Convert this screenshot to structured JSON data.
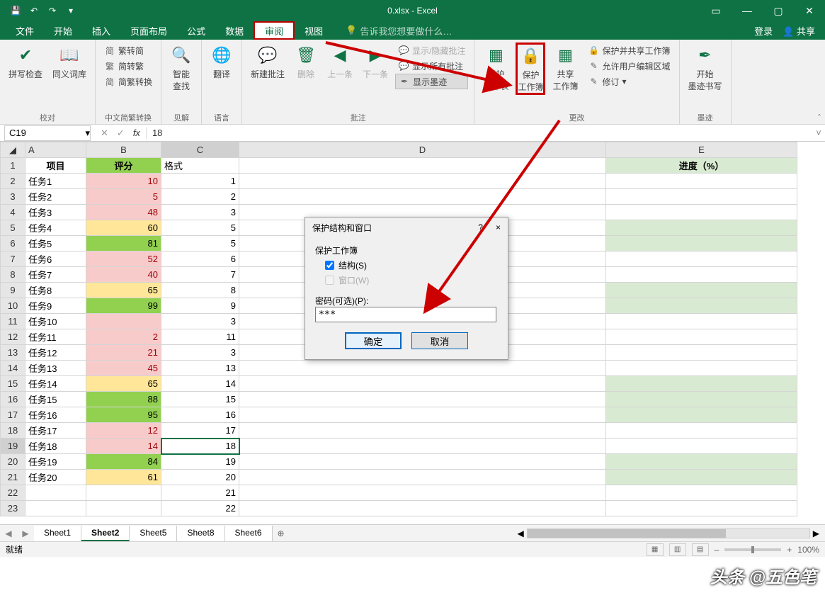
{
  "window": {
    "title": "0.xlsx - Excel"
  },
  "menubar": {
    "file": "文件",
    "home": "开始",
    "insert": "插入",
    "layout": "页面布局",
    "formulas": "公式",
    "data": "数据",
    "review": "审阅",
    "view": "视图",
    "tell": "告诉我您想要做什么…",
    "login": "登录",
    "share": "共享"
  },
  "ribbon": {
    "groups": {
      "proof": {
        "label": "校对",
        "spell": "拼写检查",
        "thesaurus": "同义词库"
      },
      "chinese": {
        "label": "中文简繁转换",
        "simp": "繁转简",
        "trad": "简转繁",
        "conv": "简繁转换"
      },
      "insights": {
        "label": "见解",
        "smart": "智能\n查找"
      },
      "lang": {
        "label": "语言",
        "translate": "翻译"
      },
      "comments": {
        "label": "批注",
        "new": "新建批注",
        "delete": "删除",
        "prev": "上一条",
        "next": "下一条",
        "showhide": "显示/隐藏批注",
        "showall": "显示所有批注",
        "ink": "显示墨迹"
      },
      "changes": {
        "label": "更改",
        "protectsheet": "保护\n工作表",
        "protectbook": "保护\n工作簿",
        "sharebook": "共享\n工作簿",
        "protectshare": "保护并共享工作簿",
        "allowedit": "允许用户编辑区域",
        "track": "修订"
      },
      "ink": {
        "label": "墨迹",
        "start": "开始\n墨迹书写"
      }
    }
  },
  "fbar": {
    "name": "C19",
    "formula": "18"
  },
  "headers": {
    "A": "项目",
    "B": "评分",
    "C": "格式",
    "E": "进度（%）"
  },
  "rows": [
    {
      "a": "任务1",
      "b": 10,
      "c": 1,
      "bc": "pink",
      "tc": "redtext"
    },
    {
      "a": "任务2",
      "b": 5,
      "c": 2,
      "bc": "pink",
      "tc": "redtext"
    },
    {
      "a": "任务3",
      "b": 48,
      "c": 3,
      "bc": "pink",
      "tc": "redtext"
    },
    {
      "a": "任务4",
      "b": 60,
      "c": 5,
      "bc": "yellow",
      "tc": ""
    },
    {
      "a": "任务5",
      "b": 81,
      "c": 5,
      "bc": "green",
      "tc": ""
    },
    {
      "a": "任务6",
      "b": 52,
      "c": 6,
      "bc": "pink",
      "tc": "redtext"
    },
    {
      "a": "任务7",
      "b": 40,
      "c": 7,
      "bc": "pink",
      "tc": "redtext"
    },
    {
      "a": "任务8",
      "b": 65,
      "c": 8,
      "bc": "yellow",
      "tc": ""
    },
    {
      "a": "任务9",
      "b": 99,
      "c": 9,
      "bc": "green",
      "tc": ""
    },
    {
      "a": "任务10",
      "b": "",
      "c": 3,
      "bc": "pink",
      "tc": ""
    },
    {
      "a": "任务11",
      "b": 2,
      "c": 11,
      "bc": "pink",
      "tc": "redtext"
    },
    {
      "a": "任务12",
      "b": 21,
      "c": 3,
      "bc": "pink",
      "tc": "redtext"
    },
    {
      "a": "任务13",
      "b": 45,
      "c": 13,
      "bc": "pink",
      "tc": "redtext"
    },
    {
      "a": "任务14",
      "b": 65,
      "c": 14,
      "bc": "yellow",
      "tc": ""
    },
    {
      "a": "任务15",
      "b": 88,
      "c": 15,
      "bc": "green",
      "tc": ""
    },
    {
      "a": "任务16",
      "b": 95,
      "c": 16,
      "bc": "green",
      "tc": ""
    },
    {
      "a": "任务17",
      "b": 12,
      "c": 17,
      "bc": "pink",
      "tc": "redtext"
    },
    {
      "a": "任务18",
      "b": 14,
      "c": 18,
      "bc": "pink",
      "tc": "redtext"
    },
    {
      "a": "任务19",
      "b": 84,
      "c": 19,
      "bc": "green",
      "tc": ""
    },
    {
      "a": "任务20",
      "b": 61,
      "c": 20,
      "bc": "yellow",
      "tc": ""
    },
    {
      "a": "",
      "b": "",
      "c": 21,
      "bc": "",
      "tc": ""
    },
    {
      "a": "",
      "b": "",
      "c": 22,
      "bc": "",
      "tc": ""
    }
  ],
  "dialog": {
    "title": "保护结构和窗口",
    "help": "?",
    "close": "×",
    "section": "保护工作簿",
    "cb1": "结构(S)",
    "cb2": "窗口(W)",
    "pwlabel": "密码(可选)(P):",
    "pwvalue": "***",
    "ok": "确定",
    "cancel": "取消"
  },
  "sheets": [
    "Sheet1",
    "Sheet2",
    "Sheet5",
    "Sheet8",
    "Sheet6"
  ],
  "status": {
    "ready": "就绪",
    "zoom": "100%"
  },
  "watermark": "头条 @五色笔"
}
